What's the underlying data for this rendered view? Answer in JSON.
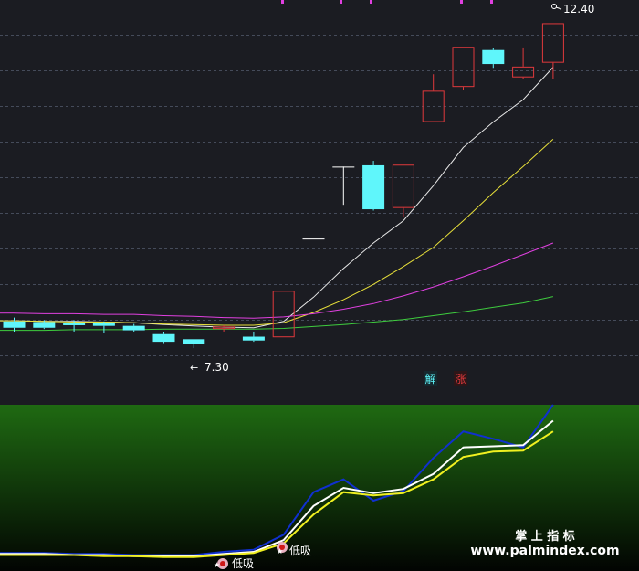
{
  "colors": {
    "background": "#1b1c22",
    "grid": "#454b5a",
    "up": "#e0393c",
    "down": "#5ff6fb",
    "ma_white": "#e8e8e8",
    "ma_yellow": "#e8e03a",
    "ma_magenta": "#e040e0",
    "ma_green": "#3ecb3e",
    "lower_top": "#1f6a12",
    "lower_bottom": "#020402",
    "line_blue": "#1030d0",
    "line_white": "#ffffff",
    "line_yellow": "#f0f020",
    "top_marker": "#e040e0"
  },
  "chart_data": [
    {
      "type": "candlestick",
      "x": [
        1,
        2,
        3,
        4,
        5,
        6,
        7,
        8,
        9,
        10,
        11,
        12,
        13,
        14,
        15,
        16,
        17,
        18,
        19
      ],
      "candles": [
        {
          "open": 7.72,
          "close": 7.62,
          "high": 7.78,
          "low": 7.56
        },
        {
          "open": 7.71,
          "close": 7.62,
          "high": 7.74,
          "low": 7.6
        },
        {
          "open": 7.7,
          "close": 7.66,
          "high": 7.74,
          "low": 7.56
        },
        {
          "open": 7.7,
          "close": 7.65,
          "high": 7.72,
          "low": 7.54
        },
        {
          "open": 7.65,
          "close": 7.58,
          "high": 7.68,
          "low": 7.56
        },
        {
          "open": 7.52,
          "close": 7.4,
          "high": 7.56,
          "low": 7.38
        },
        {
          "open": 7.44,
          "close": 7.36,
          "high": 7.44,
          "low": 7.3
        },
        {
          "open": 7.6,
          "close": 7.64,
          "high": 7.66,
          "low": 7.56
        },
        {
          "open": 7.48,
          "close": 7.42,
          "high": 7.56,
          "low": 7.4
        },
        {
          "open": 7.47,
          "close": 8.2,
          "high": 8.2,
          "low": 7.47
        },
        {
          "open": 9.02,
          "close": 9.02,
          "high": 9.02,
          "low": 9.02
        },
        {
          "open": 10.15,
          "close": 10.15,
          "high": 10.15,
          "low": 9.55
        },
        {
          "open": 10.17,
          "close": 9.48,
          "high": 10.24,
          "low": 9.46
        },
        {
          "open": 9.5,
          "close": 10.18,
          "high": 10.18,
          "low": 9.36
        },
        {
          "open": 10.85,
          "close": 11.34,
          "high": 11.6,
          "low": 10.85
        },
        {
          "open": 11.4,
          "close": 12.03,
          "high": 12.03,
          "low": 11.36
        },
        {
          "open": 11.98,
          "close": 11.76,
          "high": 12.01,
          "low": 11.7
        },
        {
          "open": 11.55,
          "close": 11.72,
          "high": 12.02,
          "low": 11.52
        },
        {
          "open": 11.78,
          "close": 12.4,
          "high": 12.4,
          "low": 11.52
        }
      ],
      "moving_averages": [
        {
          "color": "#e8e8e8",
          "values": [
            7.73,
            7.72,
            7.72,
            7.71,
            7.7,
            7.67,
            7.65,
            7.63,
            7.62,
            7.72,
            8.1,
            8.55,
            8.95,
            9.3,
            9.85,
            10.45,
            10.85,
            11.2,
            11.71
          ]
        },
        {
          "color": "#e8e03a",
          "values": [
            7.73,
            7.72,
            7.71,
            7.71,
            7.7,
            7.68,
            7.67,
            7.66,
            7.66,
            7.7,
            7.86,
            8.06,
            8.3,
            8.58,
            8.88,
            9.3,
            9.74,
            10.15,
            10.58
          ]
        },
        {
          "color": "#e040e0",
          "values": [
            7.85,
            7.84,
            7.84,
            7.83,
            7.83,
            7.81,
            7.8,
            7.78,
            7.77,
            7.79,
            7.84,
            7.91,
            8.0,
            8.12,
            8.26,
            8.42,
            8.59,
            8.77,
            8.95
          ]
        },
        {
          "color": "#3ecb3e",
          "values": [
            7.58,
            7.58,
            7.59,
            7.59,
            7.59,
            7.6,
            7.6,
            7.6,
            7.6,
            7.61,
            7.64,
            7.67,
            7.71,
            7.75,
            7.81,
            7.87,
            7.94,
            8.01,
            8.11
          ]
        }
      ],
      "annotations": [
        {
          "text": "12.40",
          "type": "high"
        },
        {
          "text": "7.30",
          "type": "low"
        },
        {
          "text": "解",
          "type": "tag"
        },
        {
          "text": "涨",
          "type": "tag"
        }
      ],
      "ylim": [
        7.0,
        12.65
      ],
      "grid": "horizontal dashed"
    },
    {
      "type": "line",
      "x": [
        1,
        2,
        3,
        4,
        5,
        6,
        7,
        8,
        9,
        10,
        11,
        12,
        13,
        14,
        15,
        16,
        17,
        18,
        19
      ],
      "series": [
        {
          "color": "#1030d0",
          "values": [
            11,
            11,
            10,
            10,
            9,
            9,
            9,
            12,
            14,
            28,
            68,
            80,
            60,
            69,
            100,
            125,
            118,
            110,
            150
          ]
        },
        {
          "color": "#ffffff",
          "values": [
            10,
            10,
            9,
            9,
            8,
            8,
            8,
            10,
            12,
            23,
            55,
            72,
            67,
            71,
            85,
            110,
            111,
            112,
            135
          ]
        },
        {
          "color": "#f0f020",
          "values": [
            9,
            9,
            9,
            8,
            8,
            7,
            7,
            9,
            11,
            20,
            47,
            68,
            65,
            67,
            80,
            101,
            106,
            107,
            125
          ]
        }
      ],
      "annotations": [
        {
          "text": "低吸"
        },
        {
          "text": "低吸"
        }
      ],
      "ylim": [
        0,
        150
      ]
    }
  ],
  "watermark": {
    "title": "掌 上 指 标",
    "url": "www.palmindex.com"
  }
}
